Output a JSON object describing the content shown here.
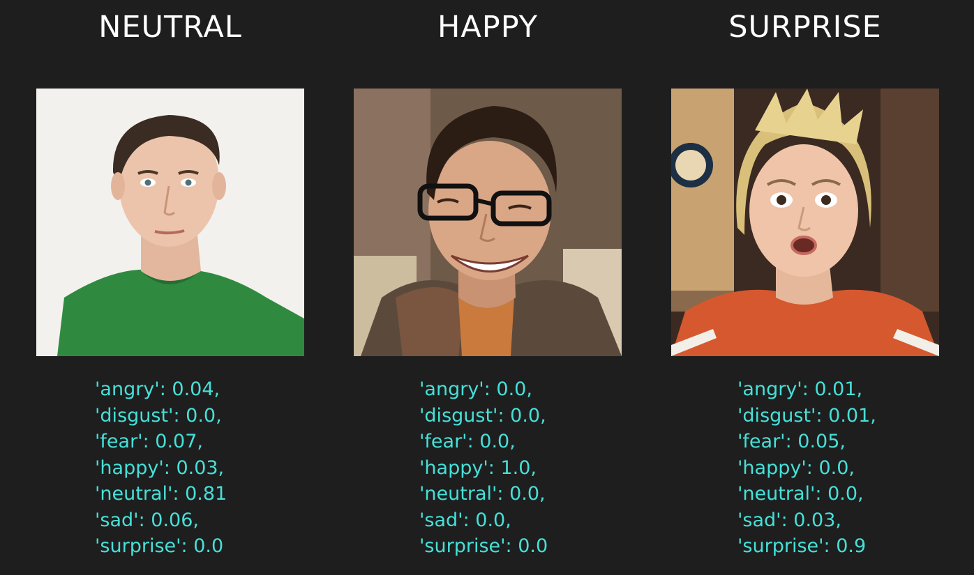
{
  "panels": [
    {
      "title": "NEUTRAL",
      "photo_icon": "portrait-photo",
      "scores": [
        "'angry': 0.04,",
        "'disgust': 0.0,",
        "'fear': 0.07,",
        "'happy': 0.03,",
        "'neutral': 0.81",
        "'sad': 0.06,",
        "'surprise': 0.0"
      ]
    },
    {
      "title": "HAPPY",
      "photo_icon": "portrait-photo",
      "scores": [
        "'angry': 0.0,",
        "'disgust': 0.0,",
        "'fear': 0.0,",
        "'happy': 1.0,",
        "'neutral': 0.0,",
        "'sad': 0.0,",
        "'surprise': 0.0"
      ]
    },
    {
      "title": "SURPRISE",
      "photo_icon": "portrait-photo",
      "scores": [
        "'angry': 0.01,",
        "'disgust': 0.01,",
        "'fear': 0.05,",
        "'happy': 0.0,",
        "'neutral': 0.0,",
        "'sad': 0.03,",
        "'surprise': 0.9"
      ]
    }
  ],
  "colors": {
    "background": "#1e1e1e",
    "title": "#ffffff",
    "scores": "#46e0d8"
  }
}
